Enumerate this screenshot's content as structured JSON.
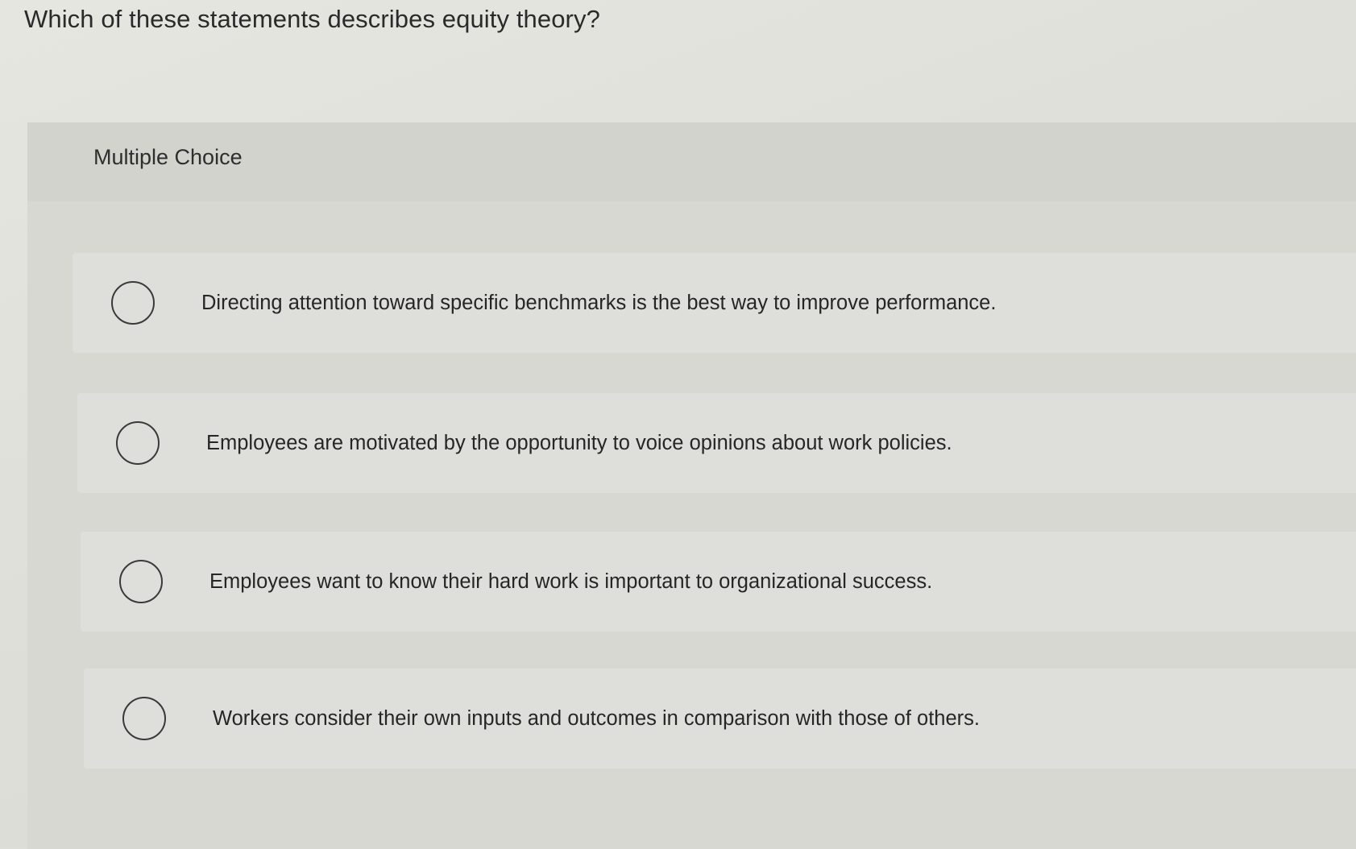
{
  "question": {
    "text": "Which of these statements describes equity theory?"
  },
  "panel": {
    "type_label": "Multiple Choice"
  },
  "options": [
    {
      "text": "Directing attention toward specific benchmarks is the best way to improve performance.",
      "selected": false
    },
    {
      "text": "Employees are motivated by the opportunity to voice opinions about work policies.",
      "selected": false
    },
    {
      "text": "Employees want to know their hard work is important to organizational success.",
      "selected": false
    },
    {
      "text": "Workers consider their own inputs and outcomes in comparison with those of others.",
      "selected": false
    }
  ],
  "colors": {
    "background": "#e2e2dd",
    "panel": "#d8d8d3",
    "option": "#dededa",
    "text": "#2a2a2a"
  }
}
